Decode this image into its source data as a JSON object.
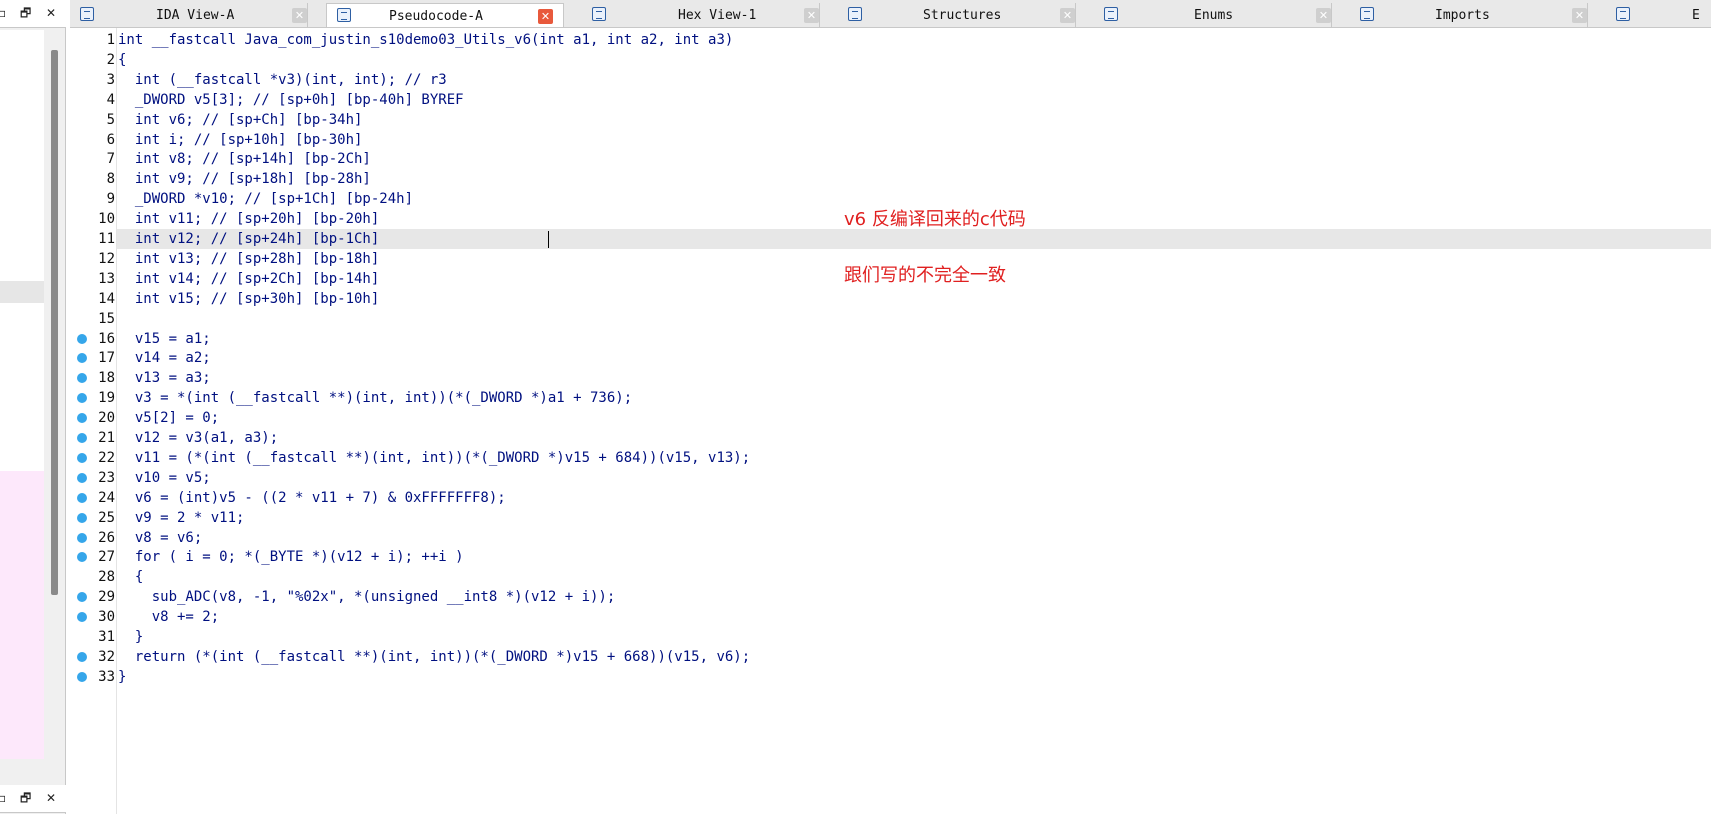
{
  "left_panel": {
    "titlebar_icons": [
      "minimize-icon",
      "restore-icon",
      "close-icon"
    ]
  },
  "tabs": [
    {
      "label": "IDA View-A",
      "icon": "ida-view-icon",
      "active": false
    },
    {
      "label": "Pseudocode-A",
      "icon": "pseudocode-icon",
      "active": true
    },
    {
      "label": "Hex View-1",
      "icon": "hex-view-icon",
      "active": false
    },
    {
      "label": "Structures",
      "icon": "structures-icon",
      "active": false
    },
    {
      "label": "Enums",
      "icon": "enums-icon",
      "active": false
    },
    {
      "label": "Imports",
      "icon": "imports-icon",
      "active": false
    },
    {
      "label": "E",
      "icon": "exports-icon",
      "active": false
    }
  ],
  "code": {
    "highlight_line": 11,
    "breakpoint_lines": [
      16,
      17,
      18,
      19,
      20,
      21,
      22,
      23,
      24,
      25,
      26,
      27,
      29,
      30,
      32,
      33
    ],
    "lines": [
      "int __fastcall Java_com_justin_s10demo03_Utils_v6(int a1, int a2, int a3)",
      "{",
      "  int (__fastcall *v3)(int, int); // r3",
      "  _DWORD v5[3]; // [sp+0h] [bp-40h] BYREF",
      "  int v6; // [sp+Ch] [bp-34h]",
      "  int i; // [sp+10h] [bp-30h]",
      "  int v8; // [sp+14h] [bp-2Ch]",
      "  int v9; // [sp+18h] [bp-28h]",
      "  _DWORD *v10; // [sp+1Ch] [bp-24h]",
      "  int v11; // [sp+20h] [bp-20h]",
      "  int v12; // [sp+24h] [bp-1Ch]",
      "  int v13; // [sp+28h] [bp-18h]",
      "  int v14; // [sp+2Ch] [bp-14h]",
      "  int v15; // [sp+30h] [bp-10h]",
      "",
      "  v15 = a1;",
      "  v14 = a2;",
      "  v13 = a3;",
      "  v3 = *(int (__fastcall **)(int, int))(*(_DWORD *)a1 + 736);",
      "  v5[2] = 0;",
      "  v12 = v3(a1, a3);",
      "  v11 = (*(int (__fastcall **)(int, int))(*(_DWORD *)v15 + 684))(v15, v13);",
      "  v10 = v5;",
      "  v6 = (int)v5 - ((2 * v11 + 7) & 0xFFFFFFF8);",
      "  v9 = 2 * v11;",
      "  v8 = v6;",
      "  for ( i = 0; *(_BYTE *)(v12 + i); ++i )",
      "  {",
      "    sub_ADC(v8, -1, \"%02x\", *(unsigned __int8 *)(v12 + i));",
      "    v8 += 2;",
      "  }",
      "  return (*(int (__fastcall **)(int, int))(*(_DWORD *)v15 + 668))(v15, v6);",
      "}"
    ]
  },
  "annotations": {
    "note_1": "v6 反编译回来的c代码",
    "note_2": "跟们写的不完全一致"
  },
  "colors": {
    "breakpoint": "#35a6ea",
    "annotation": "#e02020",
    "active_close": "#e8593c"
  }
}
